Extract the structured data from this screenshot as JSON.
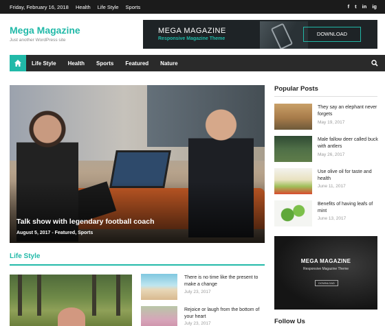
{
  "topbar": {
    "date": "Friday, February 16, 2018",
    "links": [
      "Health",
      "Life Style",
      "Sports"
    ],
    "social": [
      "f",
      "t",
      "in",
      "ig"
    ]
  },
  "header": {
    "logo": "Mega Magazine",
    "tagline": "Just another WordPress site",
    "banner": {
      "title": "MEGA MAGAZINE",
      "subtitle": "Responsive Magazine Theme",
      "button": "DOWNLOAD"
    }
  },
  "nav": {
    "items": [
      "Life Style",
      "Health",
      "Sports",
      "Featured",
      "Nature"
    ],
    "home_icon": "home-icon",
    "search_icon": "search-icon"
  },
  "featured": {
    "title": "Talk show with legendary football coach",
    "meta": "August 5, 2017 - Featured, Sports"
  },
  "lifestyle": {
    "heading": "Life Style",
    "items": [
      {
        "title": "There is no time like the present to make a change",
        "date": "July 23, 2017"
      },
      {
        "title": "Rejoice or laugh from the bottom of your heart",
        "date": "July 23, 2017"
      }
    ]
  },
  "sidebar": {
    "popular_heading": "Popular Posts",
    "popular": [
      {
        "title": "They say an elephant never forgets",
        "date": "May 19, 2017"
      },
      {
        "title": "Male fallow deer called buck with antlers",
        "date": "May 26, 2017"
      },
      {
        "title": "Use olive oil for taste and health",
        "date": "June 11, 2017"
      },
      {
        "title": "Benefits of having leafs of mint",
        "date": "June 13, 2017"
      }
    ],
    "ad": {
      "title": "MEGA MAGAZINE",
      "subtitle": "Responsive Magazine Theme",
      "button": "DOWNLOAD"
    },
    "follow_heading": "Follow Us"
  },
  "colors": {
    "accent": "#21b9a8",
    "topbar": "#1b1b1b",
    "nav": "#2a2a2a"
  }
}
